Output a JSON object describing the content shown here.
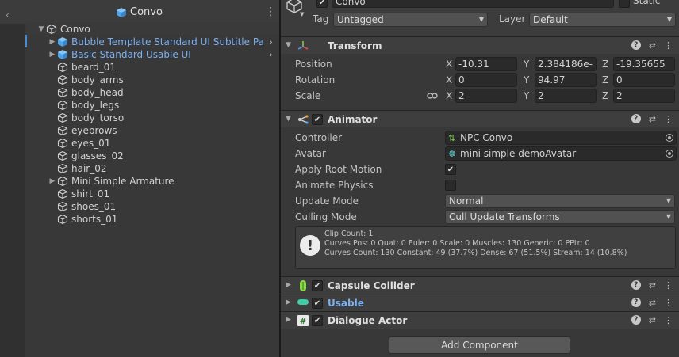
{
  "hierarchy": {
    "scene_title": "Convo",
    "root": "Convo",
    "items": [
      {
        "label": "Bubble Template Standard UI Subtitle Pane",
        "prefab": true,
        "foldable": true
      },
      {
        "label": "Basic Standard Usable UI",
        "prefab": true,
        "foldable": true
      },
      {
        "label": "beard_01"
      },
      {
        "label": "body_arms"
      },
      {
        "label": "body_head"
      },
      {
        "label": "body_legs"
      },
      {
        "label": "body_torso"
      },
      {
        "label": "eyebrows"
      },
      {
        "label": "eyes_01"
      },
      {
        "label": "glasses_02"
      },
      {
        "label": "hair_02"
      },
      {
        "label": "Mini Simple Armature",
        "foldable": true
      },
      {
        "label": "shirt_01"
      },
      {
        "label": "shoes_01"
      },
      {
        "label": "shorts_01"
      }
    ]
  },
  "inspector": {
    "object_name": "Convo",
    "static_label": "Static",
    "tag_label": "Tag",
    "tag_value": "Untagged",
    "layer_label": "Layer",
    "layer_value": "Default",
    "transform": {
      "title": "Transform",
      "position_label": "Position",
      "rotation_label": "Rotation",
      "scale_label": "Scale",
      "axis_x": "X",
      "axis_y": "Y",
      "axis_z": "Z",
      "position": {
        "x": "-10.31",
        "y": "2.384186e-",
        "z": "-19.35655"
      },
      "rotation": {
        "x": "0",
        "y": "94.97",
        "z": "0"
      },
      "scale": {
        "x": "2",
        "y": "2",
        "z": "2"
      }
    },
    "animator": {
      "title": "Animator",
      "controller_label": "Controller",
      "controller_value": "NPC Convo",
      "avatar_label": "Avatar",
      "avatar_value": "mini simple demoAvatar",
      "apply_root_motion_label": "Apply Root Motion",
      "animate_physics_label": "Animate Physics",
      "update_mode_label": "Update Mode",
      "update_mode_value": "Normal",
      "culling_mode_label": "Culling Mode",
      "culling_mode_value": "Cull Update Transforms",
      "info_line1": "Clip Count: 1",
      "info_line2": "Curves Pos: 0 Quat: 0 Euler: 0 Scale: 0 Muscles: 130 Generic: 0 PPtr: 0",
      "info_line3": "Curves Count: 130 Constant: 49 (37.7%) Dense: 67 (51.5%) Stream: 14 (10.8%)"
    },
    "capsule_collider": {
      "title": "Capsule Collider"
    },
    "usable": {
      "title": "Usable"
    },
    "dialogue_actor": {
      "title": "Dialogue Actor"
    },
    "add_component": "Add Component"
  },
  "colors": {
    "prefab_blue": "#7cb0f0",
    "selection_bar": "#4a8ad8"
  }
}
